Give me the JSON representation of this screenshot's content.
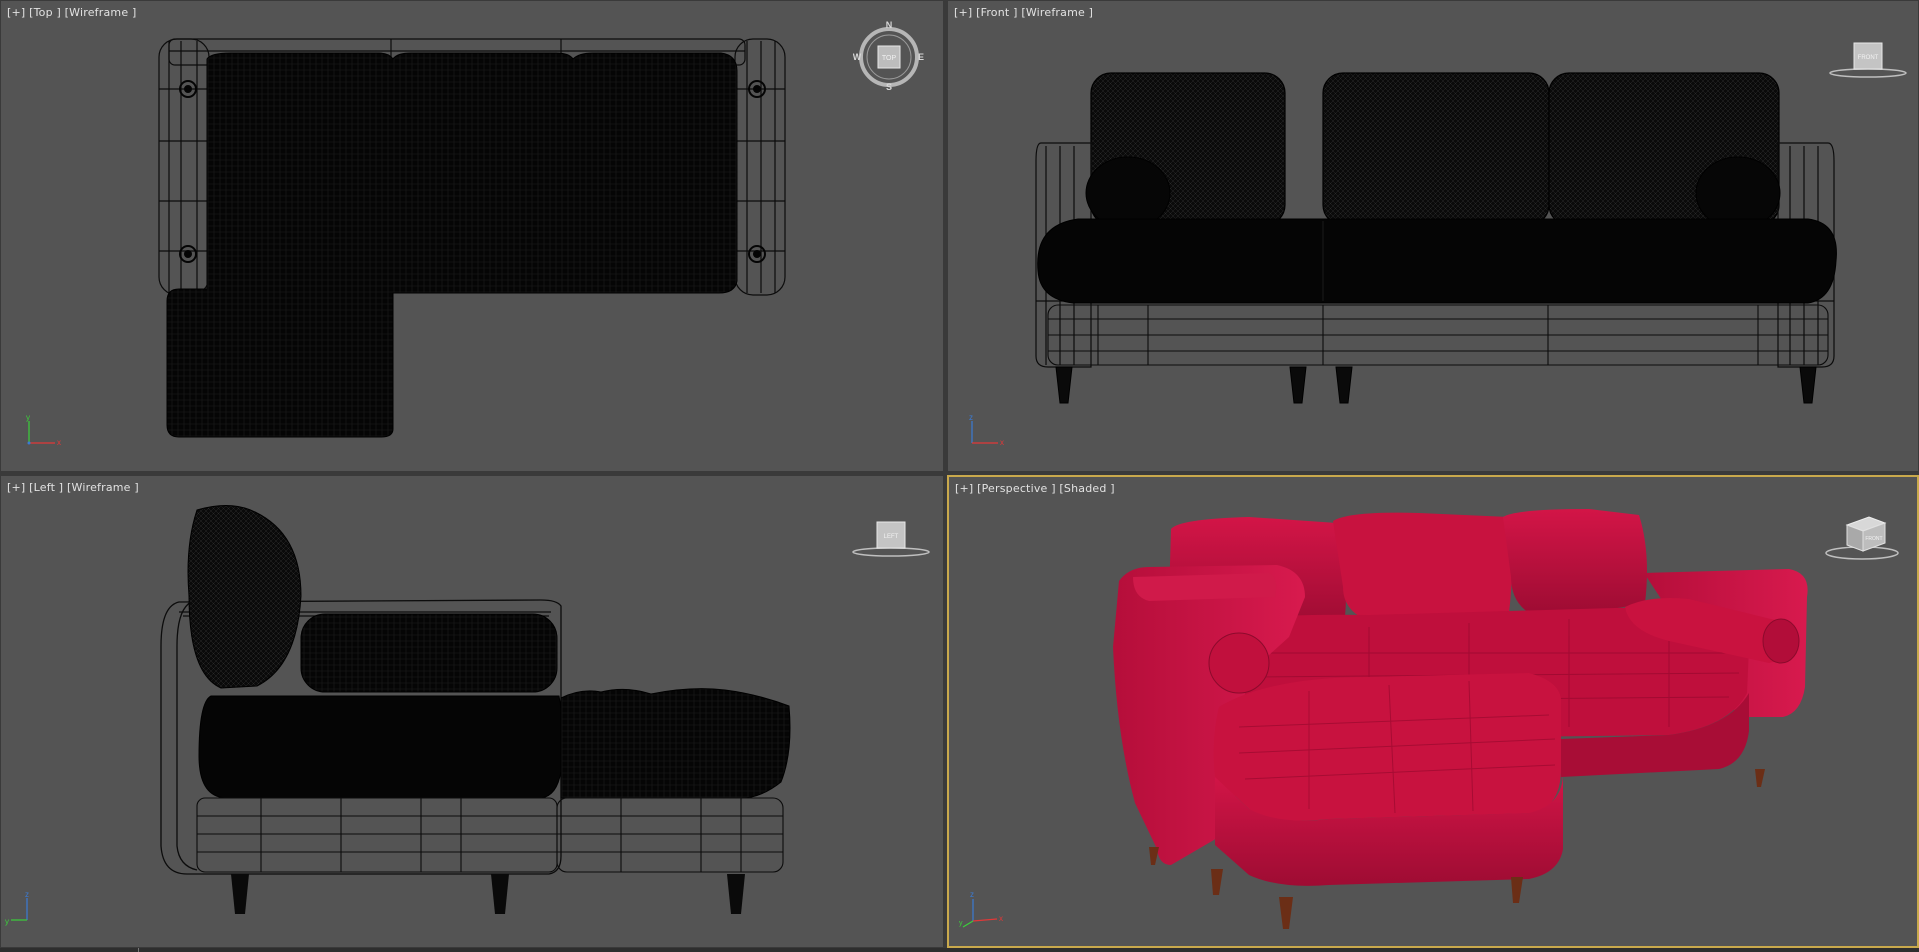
{
  "viewports": {
    "top": {
      "bracket": "[+]",
      "view": "[Top ]",
      "mode": "[Wireframe ]",
      "cube_face": "TOP",
      "compass": {
        "n": "N",
        "s": "S",
        "e": "E",
        "w": "W"
      }
    },
    "front": {
      "bracket": "[+]",
      "view": "[Front ]",
      "mode": "[Wireframe ]",
      "cube_face": "FRONT"
    },
    "left": {
      "bracket": "[+]",
      "view": "[Left ]",
      "mode": "[Wireframe ]",
      "cube_face": "LEFT"
    },
    "perspective": {
      "bracket": "[+]",
      "view": "[Perspective ]",
      "mode": "[Shaded ]",
      "cube_face": "FRONT"
    }
  },
  "axes": {
    "top": {
      "v": "y",
      "h": "x"
    },
    "front": {
      "v": "z",
      "h": "x"
    },
    "left": {
      "v": "z",
      "h": "y"
    },
    "perspective": {
      "v": "z",
      "h": "x",
      "d": "y"
    }
  },
  "colors": {
    "viewport_bg": "#545454",
    "active_border": "#c9a94c",
    "sofa_red": "#c2103d",
    "wire_dark": "#0a0a0a",
    "leg_wood": "#6b2e16"
  }
}
